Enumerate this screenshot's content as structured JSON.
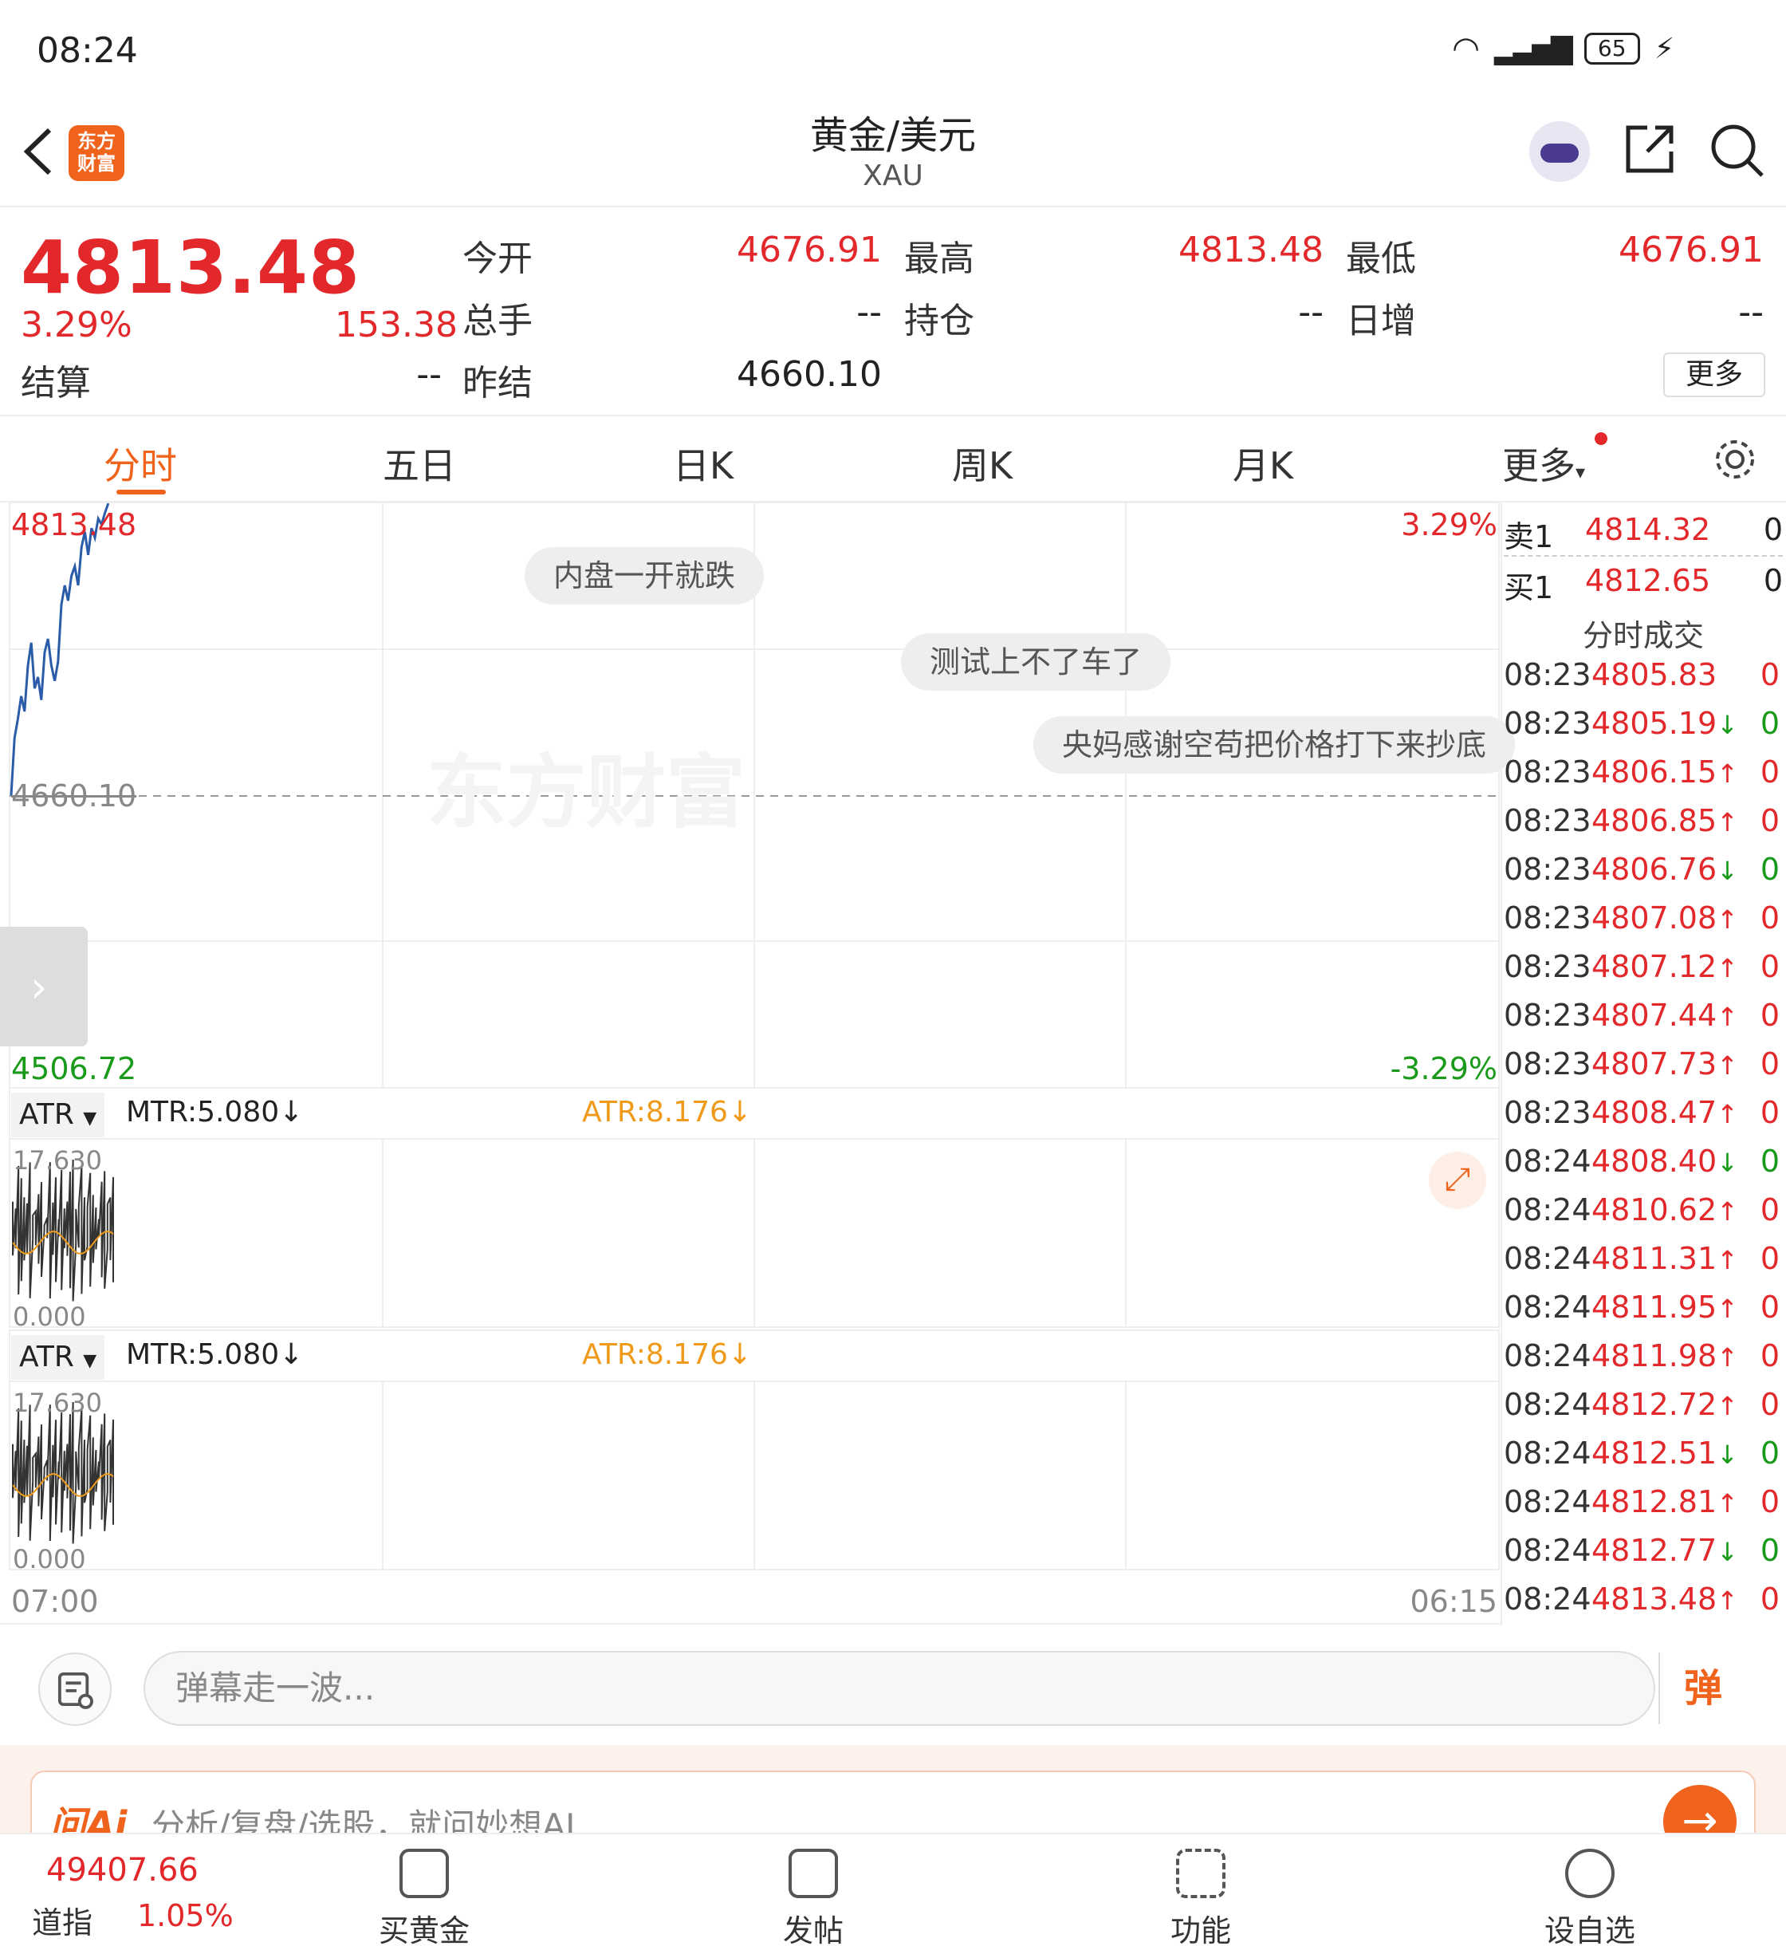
{
  "status": {
    "time": "08:24",
    "battery": "65"
  },
  "header": {
    "title": "黄金/美元",
    "subtitle": "XAU",
    "logo": "东方\n财富"
  },
  "quote": {
    "price": "4813.48",
    "change_pct": "3.29%",
    "change_abs": "153.38",
    "fields": [
      {
        "label": "今开",
        "value": "4676.91"
      },
      {
        "label": "最高",
        "value": "4813.48"
      },
      {
        "label": "最低",
        "value": "4676.91"
      },
      {
        "label": "总手",
        "value": "--"
      },
      {
        "label": "持仓",
        "value": "--"
      },
      {
        "label": "日增",
        "value": "--"
      },
      {
        "label": "结算",
        "value": "--"
      },
      {
        "label": "昨结",
        "value": "4660.10"
      }
    ],
    "more_button": "更多"
  },
  "tabs": [
    "分时",
    "五日",
    "日K",
    "周K",
    "月K",
    "更多"
  ],
  "chart": {
    "top_price": "4813.48",
    "mid_price": "4660.10",
    "bottom_price": "4506.72",
    "top_pct": "3.29%",
    "bottom_pct": "-3.29%",
    "watermark": "东方财富",
    "time_start": "07:00",
    "time_end": "06:15",
    "danmaku": [
      "内盘一开就跌",
      "测试上不了车了",
      "央妈感谢空苟把价格打下来抄底"
    ]
  },
  "indicators": [
    {
      "name": "ATR",
      "mtr": "MTR:5.080↓",
      "atr": "ATR:8.176↓",
      "max": "17.630",
      "min": "0.000"
    },
    {
      "name": "ATR",
      "mtr": "MTR:5.080↓",
      "atr": "ATR:8.176↓",
      "max": "17.630",
      "min": "0.000"
    }
  ],
  "orderbook": {
    "sell": {
      "label": "卖1",
      "price": "4814.32",
      "vol": "0"
    },
    "buy": {
      "label": "买1",
      "price": "4812.65",
      "vol": "0"
    },
    "ticks_title": "分时成交",
    "ticks": [
      {
        "time": "08:23",
        "price": "4805.83",
        "dir": "",
        "vol": "0",
        "color": "red"
      },
      {
        "time": "08:23",
        "price": "4805.19",
        "dir": "↓",
        "vol": "0",
        "color": "green"
      },
      {
        "time": "08:23",
        "price": "4806.15",
        "dir": "↑",
        "vol": "0",
        "color": "red"
      },
      {
        "time": "08:23",
        "price": "4806.85",
        "dir": "↑",
        "vol": "0",
        "color": "red"
      },
      {
        "time": "08:23",
        "price": "4806.76",
        "dir": "↓",
        "vol": "0",
        "color": "green"
      },
      {
        "time": "08:23",
        "price": "4807.08",
        "dir": "↑",
        "vol": "0",
        "color": "red"
      },
      {
        "time": "08:23",
        "price": "4807.12",
        "dir": "↑",
        "vol": "0",
        "color": "red"
      },
      {
        "time": "08:23",
        "price": "4807.44",
        "dir": "↑",
        "vol": "0",
        "color": "red"
      },
      {
        "time": "08:23",
        "price": "4807.73",
        "dir": "↑",
        "vol": "0",
        "color": "red"
      },
      {
        "time": "08:23",
        "price": "4808.47",
        "dir": "↑",
        "vol": "0",
        "color": "red"
      },
      {
        "time": "08:24",
        "price": "4808.40",
        "dir": "↓",
        "vol": "0",
        "color": "green"
      },
      {
        "time": "08:24",
        "price": "4810.62",
        "dir": "↑",
        "vol": "0",
        "color": "red"
      },
      {
        "time": "08:24",
        "price": "4811.31",
        "dir": "↑",
        "vol": "0",
        "color": "red"
      },
      {
        "time": "08:24",
        "price": "4811.95",
        "dir": "↑",
        "vol": "0",
        "color": "red"
      },
      {
        "time": "08:24",
        "price": "4811.98",
        "dir": "↑",
        "vol": "0",
        "color": "red"
      },
      {
        "time": "08:24",
        "price": "4812.72",
        "dir": "↑",
        "vol": "0",
        "color": "red"
      },
      {
        "time": "08:24",
        "price": "4812.51",
        "dir": "↓",
        "vol": "0",
        "color": "green"
      },
      {
        "time": "08:24",
        "price": "4812.81",
        "dir": "↑",
        "vol": "0",
        "color": "red"
      },
      {
        "time": "08:24",
        "price": "4812.77",
        "dir": "↓",
        "vol": "0",
        "color": "green"
      },
      {
        "time": "08:24",
        "price": "4813.48",
        "dir": "↑",
        "vol": "0",
        "color": "red"
      }
    ]
  },
  "danmu_input": {
    "placeholder": "弹幕走一波...",
    "send": "弹"
  },
  "ai": {
    "logo": "问Ai",
    "text": "分析/复盘/选股，就问妙想AI"
  },
  "bottom_nav": {
    "index_value": "49407.66",
    "index_name": "道指",
    "index_pct": "1.05%",
    "items": [
      "买黄金",
      "发帖",
      "功能",
      "设自选"
    ]
  }
}
